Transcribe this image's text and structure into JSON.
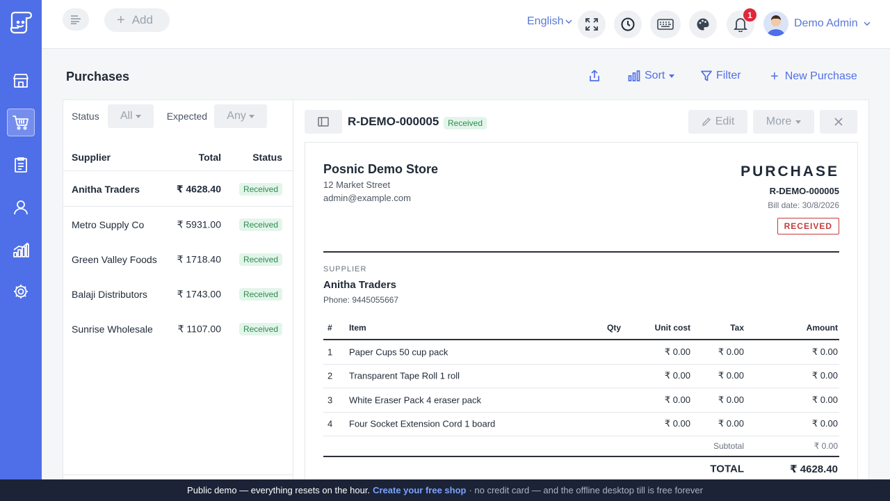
{
  "topbar": {
    "add_label": "Add",
    "language": "English",
    "notifications_count": "1",
    "user_name": "Demo Admin"
  },
  "page": {
    "title": "Purchases",
    "sort_label": "Sort",
    "filter_label": "Filter",
    "new_label": "New Purchase"
  },
  "filters": {
    "status_label": "Status",
    "status_value": "All",
    "expected_label": "Expected",
    "expected_value": "Any"
  },
  "list": {
    "headers": {
      "supplier": "Supplier",
      "total": "Total",
      "status": "Status"
    },
    "rows": [
      {
        "supplier": "Anitha Traders",
        "total": "₹ 4628.40",
        "status": "Received"
      },
      {
        "supplier": "Metro Supply Co",
        "total": "₹ 5931.00",
        "status": "Received"
      },
      {
        "supplier": "Green Valley Foods",
        "total": "₹ 1718.40",
        "status": "Received"
      },
      {
        "supplier": "Balaji Distributors",
        "total": "₹ 1743.00",
        "status": "Received"
      },
      {
        "supplier": "Sunrise Wholesale",
        "total": "₹ 1107.00",
        "status": "Received"
      }
    ]
  },
  "detail": {
    "id": "R-DEMO-000005",
    "status_badge": "Received",
    "edit_label": "Edit",
    "more_label": "More",
    "store": {
      "name": "Posnic Demo Store",
      "address": "12 Market Street",
      "email": "admin@example.com"
    },
    "doc_type": "PURCHASE",
    "doc_id": "R-DEMO-000005",
    "bill_date": "Bill date: 30/8/2026",
    "stamp": "RECEIVED",
    "supplier_label": "SUPPLIER",
    "supplier_name": "Anitha Traders",
    "supplier_phone": "Phone: 9445055667",
    "columns": {
      "num": "#",
      "item": "Item",
      "qty": "Qty",
      "unit_cost": "Unit cost",
      "tax": "Tax",
      "amount": "Amount"
    },
    "items": [
      {
        "num": "1",
        "item": "Paper Cups 50 cup pack",
        "qty": "",
        "unit_cost": "₹ 0.00",
        "tax": "₹ 0.00",
        "amount": "₹ 0.00"
      },
      {
        "num": "2",
        "item": "Transparent Tape Roll 1 roll",
        "qty": "",
        "unit_cost": "₹ 0.00",
        "tax": "₹ 0.00",
        "amount": "₹ 0.00"
      },
      {
        "num": "3",
        "item": "White Eraser Pack 4 eraser pack",
        "qty": "",
        "unit_cost": "₹ 0.00",
        "tax": "₹ 0.00",
        "amount": "₹ 0.00"
      },
      {
        "num": "4",
        "item": "Four Socket Extension Cord 1 board",
        "qty": "",
        "unit_cost": "₹ 0.00",
        "tax": "₹ 0.00",
        "amount": "₹ 0.00"
      }
    ],
    "subtotal_label": "Subtotal",
    "subtotal_value": "₹ 0.00",
    "total_label": "TOTAL",
    "total_value": "₹ 4628.40"
  },
  "banner": {
    "text": "Public demo — everything resets on the hour.",
    "link": "Create your free shop",
    "tail": "· no credit card — and the offline desktop till is free forever"
  },
  "colors": {
    "accent": "#4f6fe8",
    "sidebar": "#4f6fe8",
    "banner": "#1c2336",
    "success": "#2e8a4e",
    "danger": "#c53b3b"
  }
}
